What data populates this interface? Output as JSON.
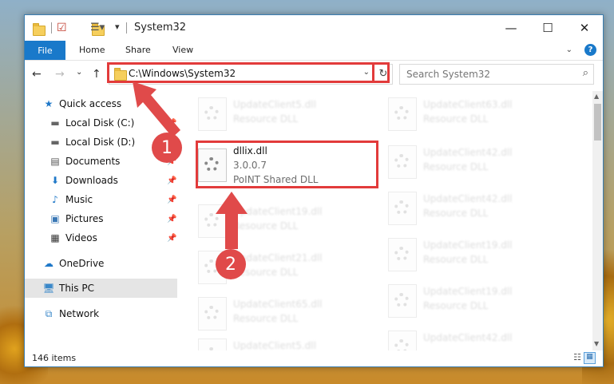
{
  "window": {
    "title": "System32",
    "tabs": {
      "file": "File",
      "home": "Home",
      "share": "Share",
      "view": "View"
    },
    "controls": {
      "minimize": "—",
      "maximize": "☐",
      "close": "✕"
    },
    "help": "?"
  },
  "navigation": {
    "back": "←",
    "forward": "→",
    "recent": "⌄",
    "up": "↑",
    "address": "C:\\Windows\\System32",
    "search_placeholder": "Search System32"
  },
  "sidebar": {
    "quick_access": "Quick access",
    "items": [
      {
        "label": "Local Disk (C:)",
        "pinned": true
      },
      {
        "label": "Local Disk (D:)",
        "pinned": true
      },
      {
        "label": "Documents",
        "pinned": true
      },
      {
        "label": "Downloads",
        "pinned": true
      },
      {
        "label": "Music",
        "pinned": true
      },
      {
        "label": "Pictures",
        "pinned": true
      },
      {
        "label": "Videos",
        "pinned": true
      }
    ],
    "onedrive": "OneDrive",
    "this_pc": "This PC",
    "network": "Network"
  },
  "files": {
    "highlight": {
      "name": "dllix.dll",
      "version": "3.0.0.7",
      "description": "PoINT Shared DLL"
    },
    "left": [
      {
        "name": "UpdateClient5.dll",
        "desc": "Resource DLL"
      },
      {
        "name": "UpdateClient19.dll",
        "desc": "Resource DLL"
      },
      {
        "name": "UpdateClient21.dll",
        "desc": "Resource DLL"
      },
      {
        "name": "UpdateClient65.dll",
        "desc": "Resource DLL"
      },
      {
        "name": "UpdateClient5.dll",
        "desc": "Resource DLL"
      }
    ],
    "right": [
      {
        "name": "UpdateClient63.dll",
        "desc": "Resource DLL"
      },
      {
        "name": "UpdateClient42.dll",
        "desc": "Resource DLL"
      },
      {
        "name": "UpdateClient42.dll",
        "desc": "Resource DLL"
      },
      {
        "name": "UpdateClient19.dll",
        "desc": "Resource DLL"
      },
      {
        "name": "UpdateClient19.dll",
        "desc": "Resource DLL"
      },
      {
        "name": "UpdateClient42.dll",
        "desc": "Resource DLL"
      }
    ]
  },
  "status": {
    "items": "146 items"
  },
  "annotations": {
    "step1": "1",
    "step2": "2",
    "color": "#e04a4a"
  }
}
